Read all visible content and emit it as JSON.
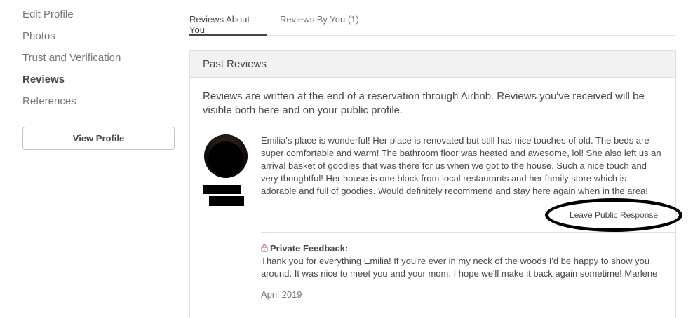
{
  "sidebar": {
    "items": [
      {
        "label": "Edit Profile"
      },
      {
        "label": "Photos"
      },
      {
        "label": "Trust and Verification"
      },
      {
        "label": "Reviews"
      },
      {
        "label": "References"
      }
    ],
    "view_profile_label": "View Profile"
  },
  "tabs": [
    {
      "label": "Reviews About You"
    },
    {
      "label": "Reviews By You (1)"
    }
  ],
  "panel": {
    "title": "Past Reviews",
    "intro": "Reviews are written at the end of a reservation through Airbnb. Reviews you've received will be visible both here and on your public profile."
  },
  "review": {
    "text": "Emilia's place is wonderful! Her place is renovated but still has nice touches of old. The beds are super comfortable and warm! The bathroom floor was heated and awesome, lol! She also left us an arrival basket of goodies that was there for us when we got to the house. Such a nice touch and very thoughtful! Her house is one block from local restaurants and her family store which is adorable and full of goodies. Would definitely recommend and stay here again when in the area!",
    "response_label": "Leave Public Response",
    "private_feedback_title": "Private Feedback:",
    "private_feedback_text": "Thank you for everything Emilia! If you're ever in my neck of the woods I'd be happy to show you around. It was nice to meet you and your mom. I hope we'll make it back again sometime! Marlene",
    "date": "April 2019",
    "icons": {
      "private": "lock-icon",
      "avatar": "avatar"
    }
  },
  "colors": {
    "accent_pink": "#ff5a5f",
    "text": "#484848",
    "muted": "#767676"
  }
}
